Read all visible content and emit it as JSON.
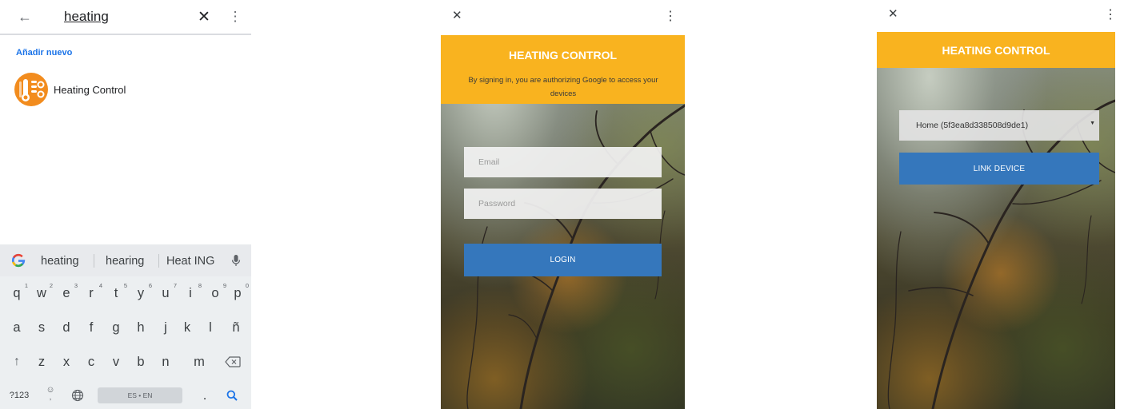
{
  "screen1": {
    "search_query": "heating",
    "section_label": "Añadir nuevo",
    "results": [
      {
        "label": "Heating Control",
        "icon": "heating-control-app-icon"
      }
    ],
    "keyboard": {
      "suggestions": [
        "heating",
        "hearing",
        "Heat ING"
      ],
      "row1": [
        {
          "key": "q",
          "hint": "1"
        },
        {
          "key": "w",
          "hint": "2"
        },
        {
          "key": "e",
          "hint": "3"
        },
        {
          "key": "r",
          "hint": "4"
        },
        {
          "key": "t",
          "hint": "5"
        },
        {
          "key": "y",
          "hint": "6"
        },
        {
          "key": "u",
          "hint": "7"
        },
        {
          "key": "i",
          "hint": "8"
        },
        {
          "key": "o",
          "hint": "9"
        },
        {
          "key": "p",
          "hint": "0"
        }
      ],
      "row2": [
        "a",
        "s",
        "d",
        "f",
        "g",
        "h",
        "j",
        "k",
        "l",
        "ñ"
      ],
      "row3": [
        "z",
        "x",
        "c",
        "v",
        "b",
        "n",
        "m"
      ],
      "symbols_key": "?123",
      "emoji_key": "☺",
      "emoji_hint": ",",
      "space_label": "ES • EN",
      "period_key": "."
    },
    "accent_color": "#1a73e8",
    "app_icon_color": "#f28c1e"
  },
  "screen2": {
    "title": "HEATING CONTROL",
    "subtitle": "By signing in, you are authorizing Google to access your devices",
    "email_placeholder": "Email",
    "password_placeholder": "Password",
    "login_label": "LOGIN",
    "brand_color": "#f9b31f",
    "button_color": "#3577bc"
  },
  "screen3": {
    "title": "HEATING CONTROL",
    "home_selected": "Home (5f3ea8d338508d9de1)",
    "link_label": "LINK DEVICE",
    "brand_color": "#f9b31f",
    "button_color": "#3577bc"
  }
}
